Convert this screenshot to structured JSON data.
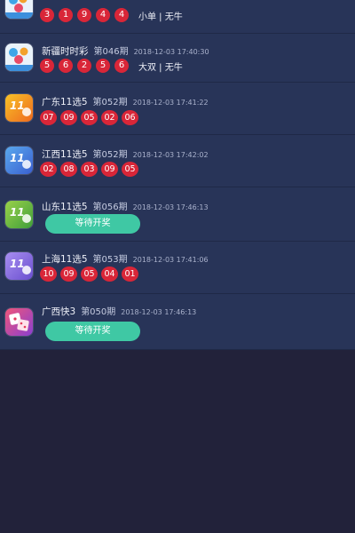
{
  "items": [
    {
      "name": "",
      "issue": "",
      "time": "",
      "numbers": [
        "3",
        "1",
        "9",
        "4",
        "4"
      ],
      "extra": "小单 | 无牛",
      "icon": "lottery-ball-icon"
    },
    {
      "name": "新疆时时彩",
      "issue": "第046期",
      "time": "2018-12-03 17:40:30",
      "numbers": [
        "5",
        "6",
        "2",
        "5",
        "6"
      ],
      "extra": "大双 | 无牛",
      "icon": "lottery-ball-icon"
    },
    {
      "name": "广东11选5",
      "issue": "第052期",
      "time": "2018-12-03 17:41:22",
      "numbers": [
        "07",
        "09",
        "05",
        "02",
        "06"
      ],
      "icon": "eleven-five-icon"
    },
    {
      "name": "江西11选5",
      "issue": "第052期",
      "time": "2018-12-03 17:42:02",
      "numbers": [
        "02",
        "08",
        "03",
        "09",
        "05"
      ],
      "icon": "eleven-five-icon"
    },
    {
      "name": "山东11选5",
      "issue": "第056期",
      "time": "2018-12-03 17:46:13",
      "button": "等待开奖",
      "icon": "eleven-five-icon"
    },
    {
      "name": "上海11选5",
      "issue": "第053期",
      "time": "2018-12-03 17:41:06",
      "numbers": [
        "10",
        "09",
        "05",
        "04",
        "01"
      ],
      "icon": "eleven-five-icon"
    },
    {
      "name": "广西快3",
      "issue": "第050期",
      "time": "2018-12-03 17:46:13",
      "button": "等待开奖",
      "icon": "dice-icon"
    }
  ],
  "colors": {
    "ball": "#d92638",
    "wait_button": "#3fc8a4",
    "row_background": "#283458",
    "page_background": "#22223a"
  }
}
